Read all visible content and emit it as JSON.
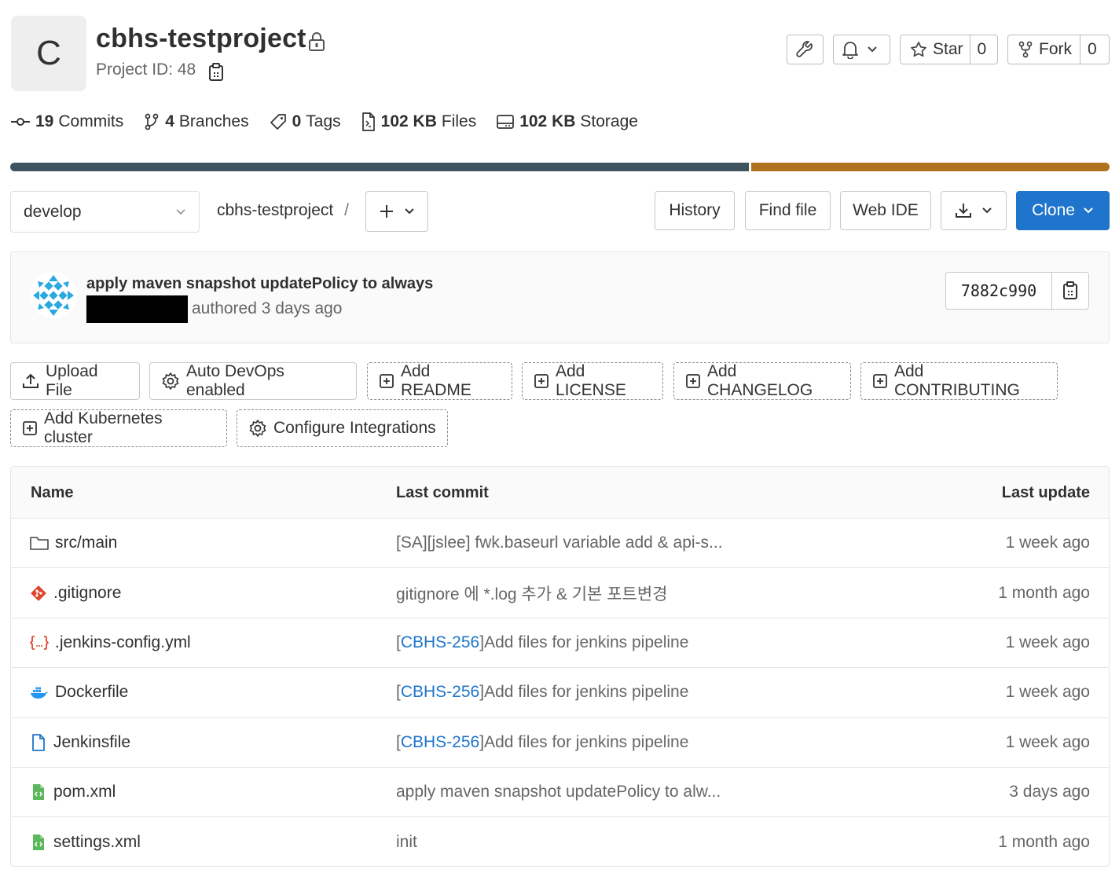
{
  "project": {
    "avatar_letter": "C",
    "name": "cbhs-testproject",
    "id_label": "Project ID: 48"
  },
  "header_actions": {
    "star_label": "Star",
    "star_count": "0",
    "fork_label": "Fork",
    "fork_count": "0"
  },
  "stats": [
    {
      "value": "19",
      "label": "Commits"
    },
    {
      "value": "4",
      "label": "Branches"
    },
    {
      "value": "0",
      "label": "Tags"
    },
    {
      "value": "102 KB",
      "label": "Files"
    },
    {
      "value": "102 KB",
      "label": "Storage"
    }
  ],
  "language_bar": {
    "colors": [
      "#3e5360",
      "#b0721f"
    ],
    "fractions": [
      0.67,
      0.33
    ]
  },
  "toolbar": {
    "branch": "develop",
    "breadcrumb": "cbhs-testproject",
    "breadcrumb_sep": "/",
    "history": "History",
    "find_file": "Find file",
    "web_ide": "Web IDE",
    "clone": "Clone"
  },
  "last_commit": {
    "title": "apply maven snapshot updatePolicy to always",
    "meta": "authored 3 days ago",
    "sha": "7882c990"
  },
  "actions": {
    "upload": "Upload File",
    "auto_devops": "Auto DevOps enabled",
    "add_readme": "Add README",
    "add_license": "Add LICENSE",
    "add_changelog": "Add CHANGELOG",
    "add_contributing": "Add CONTRIBUTING",
    "add_k8s": "Add Kubernetes cluster",
    "configure_integrations": "Configure Integrations"
  },
  "table": {
    "headers": {
      "name": "Name",
      "last_commit": "Last commit",
      "last_update": "Last update"
    },
    "rows": [
      {
        "name": "src/main",
        "icon": "folder-icon",
        "commit_ref": "",
        "commit": "[SA][jslee] fwk.baseurl variable add & api-s...",
        "updated": "1 week ago"
      },
      {
        "name": ".gitignore",
        "icon": "git-icon",
        "commit_ref": "",
        "commit": "gitignore 에 *.log 추가 & 기본 포트변경",
        "updated": "1 month ago"
      },
      {
        "name": ".jenkins-config.yml",
        "icon": "yaml-icon",
        "commit_ref": "CBHS-256",
        "commit": " Add files for jenkins pipeline",
        "updated": "1 week ago"
      },
      {
        "name": "Dockerfile",
        "icon": "docker-icon",
        "commit_ref": "CBHS-256",
        "commit": " Add files for jenkins pipeline",
        "updated": "1 week ago"
      },
      {
        "name": "Jenkinsfile",
        "icon": "file-icon",
        "commit_ref": "CBHS-256",
        "commit": " Add files for jenkins pipeline",
        "updated": "1 week ago"
      },
      {
        "name": "pom.xml",
        "icon": "xml-icon",
        "commit_ref": "",
        "commit": "apply maven snapshot updatePolicy to alw...",
        "updated": "3 days ago"
      },
      {
        "name": "settings.xml",
        "icon": "xml-icon",
        "commit_ref": "",
        "commit": "init",
        "updated": "1 month ago"
      }
    ]
  },
  "colors": {
    "accent": "#1f75cb",
    "lang_primary": "#3e5360",
    "lang_secondary": "#b0721f"
  }
}
